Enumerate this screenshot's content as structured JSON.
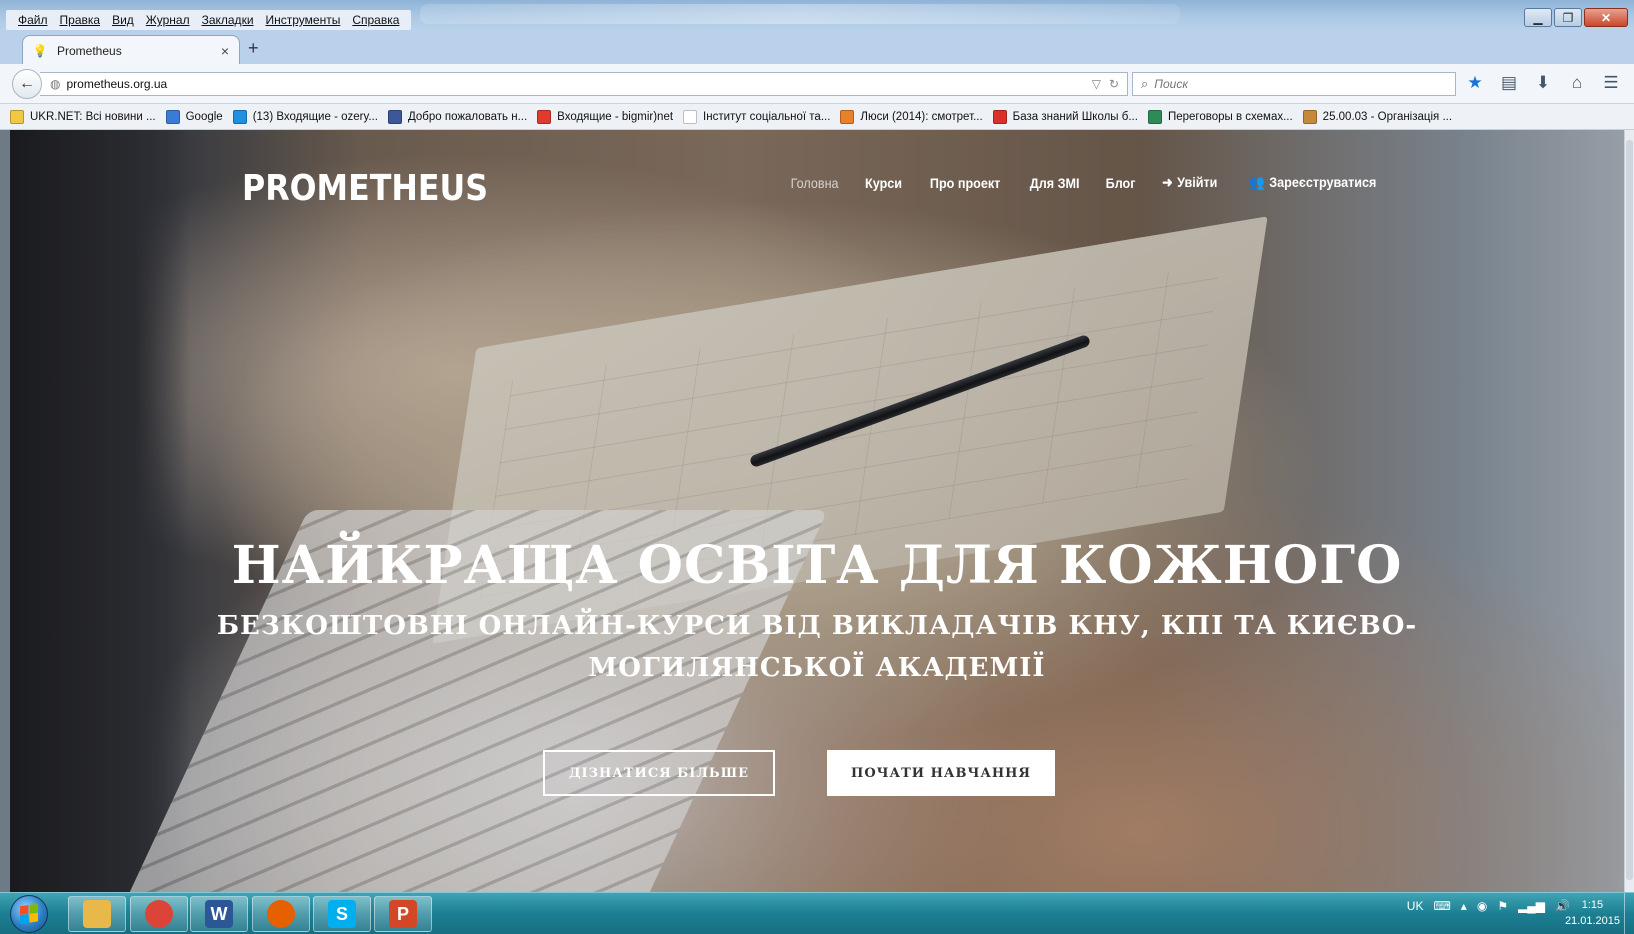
{
  "browser": {
    "menu": [
      "Файл",
      "Правка",
      "Вид",
      "Журнал",
      "Закладки",
      "Инструменты",
      "Справка"
    ],
    "tab": {
      "title": "Prometheus",
      "close": "×"
    },
    "new_tab": "+",
    "url": "prometheus.org.ua",
    "search_placeholder": "Поиск",
    "bookmarks": [
      {
        "label": "UKR.NET: Всі новини ...",
        "icon_color": "#f2c744"
      },
      {
        "label": "Google",
        "icon_color": "#3a7bd5"
      },
      {
        "label": "(13) Входящие - ozery...",
        "icon_color": "#1f8fe0"
      },
      {
        "label": "Добро пожаловать н...",
        "icon_color": "#3b5998"
      },
      {
        "label": "Входящие - bigmir)net",
        "icon_color": "#e03a2f"
      },
      {
        "label": "Інститут соціальної та...",
        "icon_color": "#ffffff"
      },
      {
        "label": "Люси (2014): смотрет...",
        "icon_color": "#e8812b"
      },
      {
        "label": "База знаний Школы б...",
        "icon_color": "#d9302a"
      },
      {
        "label": "Переговоры в схемах...",
        "icon_color": "#2e8b57"
      },
      {
        "label": "25.00.03 - Організація ...",
        "icon_color": "#c48a3a"
      }
    ]
  },
  "site": {
    "logo": "PROMETHEUS",
    "nav": [
      {
        "label": "Головна",
        "active": true
      },
      {
        "label": "Курси"
      },
      {
        "label": "Про проект"
      },
      {
        "label": "Для ЗМІ"
      },
      {
        "label": "Блог"
      },
      {
        "label": "Увійти",
        "icon": "sign-in-icon"
      },
      {
        "label": "Зареєструватися",
        "icon": "users-icon"
      }
    ],
    "hero_title": "НАЙКРАЩА ОСВІТА ДЛЯ КОЖНОГО",
    "hero_subtitle": "БЕЗКОШТОВНІ ОНЛАЙН-КУРСИ ВІД ВИКЛАДАЧІВ КНУ, КПІ ТА КИЄВО-МОГИЛЯНСЬКОЇ АКАДЕМІЇ",
    "btn_more": "ДІЗНАТИСЯ БІЛЬШЕ",
    "btn_start": "ПОЧАТИ НАВЧАННЯ"
  },
  "taskbar": {
    "apps": [
      {
        "name": "explorer",
        "color": "#e8b84a"
      },
      {
        "name": "chrome",
        "color": "#db4437"
      },
      {
        "name": "word",
        "color": "#2b5797",
        "glyph": "W"
      },
      {
        "name": "firefox",
        "color": "#e66000"
      },
      {
        "name": "skype",
        "color": "#00aff0",
        "glyph": "S"
      },
      {
        "name": "powerpoint",
        "color": "#d24726",
        "glyph": "P"
      }
    ],
    "lang": "UK",
    "time": "1:15",
    "date": "21.01.2015"
  }
}
